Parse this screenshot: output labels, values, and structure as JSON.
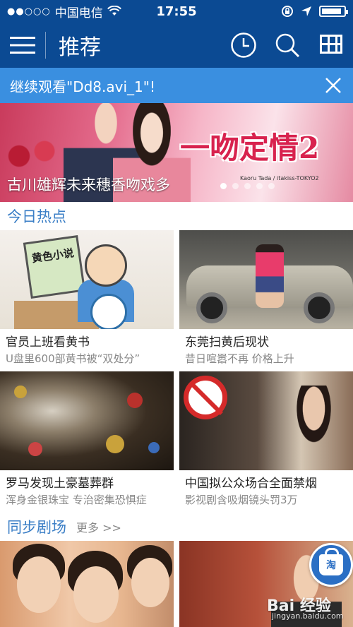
{
  "status_bar": {
    "carrier": "中国电信",
    "time": "17:55",
    "battery_level": 0.9
  },
  "nav": {
    "title": "推荐",
    "icons": [
      "menu-icon",
      "history-clock-icon",
      "search-icon",
      "grid-apps-icon"
    ]
  },
  "continue_banner": {
    "text": "继续观看\"Dd8.avi_1\"!"
  },
  "hero": {
    "logo_text": "一吻定情2",
    "logo_sub": "Kaoru Tada / itakiss-TOKYO2",
    "caption": "古川雄辉未来穗香吻戏多",
    "dot_count": 5,
    "active_dot": 0
  },
  "sections": {
    "hot_today": {
      "title": "今日热点",
      "cards": [
        {
          "title": "官员上班看黄书",
          "subtitle": "U盘里600部黄书被“双处分”"
        },
        {
          "title": "东莞扫黄后现状",
          "subtitle": "昔日喧嚣不再 价格上升"
        },
        {
          "title": "罗马发现土豪墓葬群",
          "subtitle": "浑身金银珠宝 专治密集恐惧症"
        },
        {
          "title": "中国拟公众场合全面禁烟",
          "subtitle": "影视剧含吸烟镜头罚3万"
        }
      ]
    },
    "sync_drama": {
      "title": "同步剧场",
      "more": "更多 >>"
    }
  },
  "cartoon_text": "黄色小说",
  "shop_button": {
    "label": "淘"
  },
  "watermark": {
    "text": "Bai 经验",
    "sub": "jingyan.baidu.com"
  },
  "colors": {
    "nav_bg": "#0b4a93",
    "banner_bg": "#3a8fe0",
    "section_title": "#3a7ec6"
  }
}
